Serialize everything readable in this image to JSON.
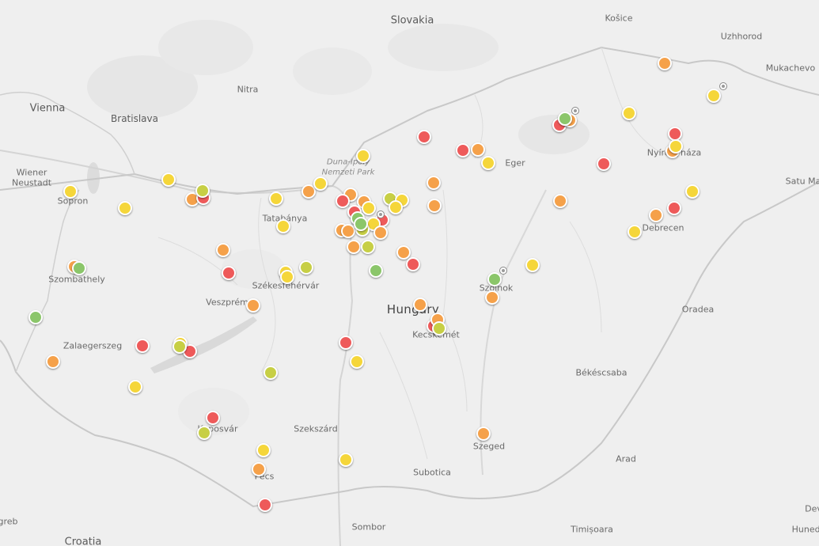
{
  "map": {
    "labels": {
      "slovakia": "Slovakia",
      "kosice": "Košice",
      "uzhhorod": "Uzhhorod",
      "mukachevo": "Mukachevo",
      "vienna": "Vienna",
      "bratislava": "Bratislava",
      "nitra": "Nitra",
      "wiener_neustadt_1": "Wiener",
      "wiener_neustadt_2": "Neustadt",
      "sopron": "Sopron",
      "duna_ipoly_1": "Duna-Ipoly",
      "duna_ipoly_2": "Nemzeti Park",
      "eger": "Eger",
      "nyiregyhaza": "Nyíregyháza",
      "satu_mare": "Satu Ma",
      "tatabanya": "Tatabánya",
      "debrecen": "Debrecen",
      "szombathely": "Szombathely",
      "szekesfehervar": "Székesfehérvár",
      "veszprem": "Veszprém",
      "szolnok": "Szolnok",
      "hungary": "Hungary",
      "oradea": "Oradea",
      "kecskemet": "Kecskemét",
      "zalaegerszeg": "Zalaegerszeg",
      "bekescsaba": "Békéscsaba",
      "kaposvar": "Kaposvár",
      "szekszard": "Szekszárd",
      "szeged": "Szeged",
      "arad": "Arad",
      "pecs": "Pécs",
      "subotica": "Subotica",
      "sombor": "Sombor",
      "timisoara": "Timișoara",
      "zagreb": "greb",
      "croatia": "Croatia",
      "hunedoara": "Hunedo",
      "deva": "Dev"
    },
    "colors": {
      "red": "#ee5a5a",
      "orange": "#f5a14a",
      "yellow": "#f5d63a",
      "lime": "#c7cf45",
      "green": "#8bc66a"
    }
  }
}
